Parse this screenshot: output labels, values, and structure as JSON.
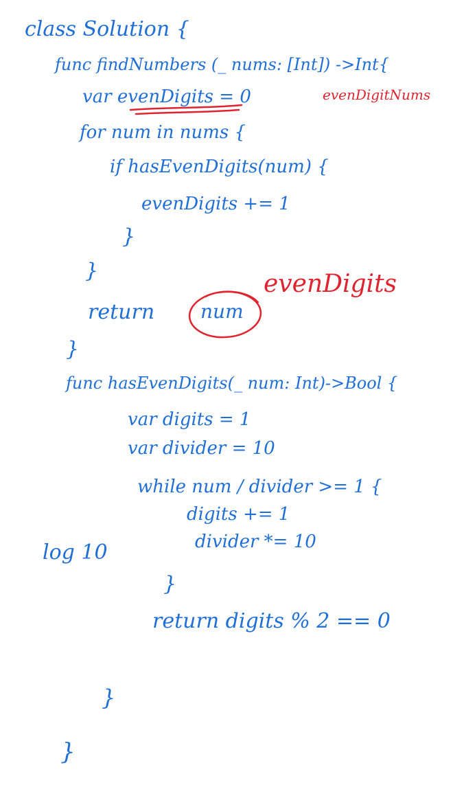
{
  "colors": {
    "ink_blue": "#1f6fd6",
    "ink_red": "#e0242f",
    "background": "#ffffff"
  },
  "lines": {
    "l01": "class Solution {",
    "l02": "func findNumbers (_ nums: [Int]) ->Int{",
    "l03": "var evenDigits = 0",
    "l03_note": "evenDigitNums",
    "l04": "for num in nums {",
    "l05": "if hasEvenDigits(num) {",
    "l06": "evenDigits += 1",
    "l07": "}",
    "l08": "}",
    "l09_keyword": "return",
    "l09_circled": "num",
    "l09_fix": "evenDigits",
    "l10": "}",
    "l11": "func hasEvenDigits(_ num: Int)->Bool {",
    "l12": "var digits = 1",
    "l13": "var divider = 10",
    "l14": "while num / divider >= 1 {",
    "l15": "digits += 1",
    "l16": "divider *= 10",
    "l17": "}",
    "l18": "return digits % 2 == 0",
    "l19": "}",
    "l20": "}",
    "margin_note": "log 10"
  }
}
